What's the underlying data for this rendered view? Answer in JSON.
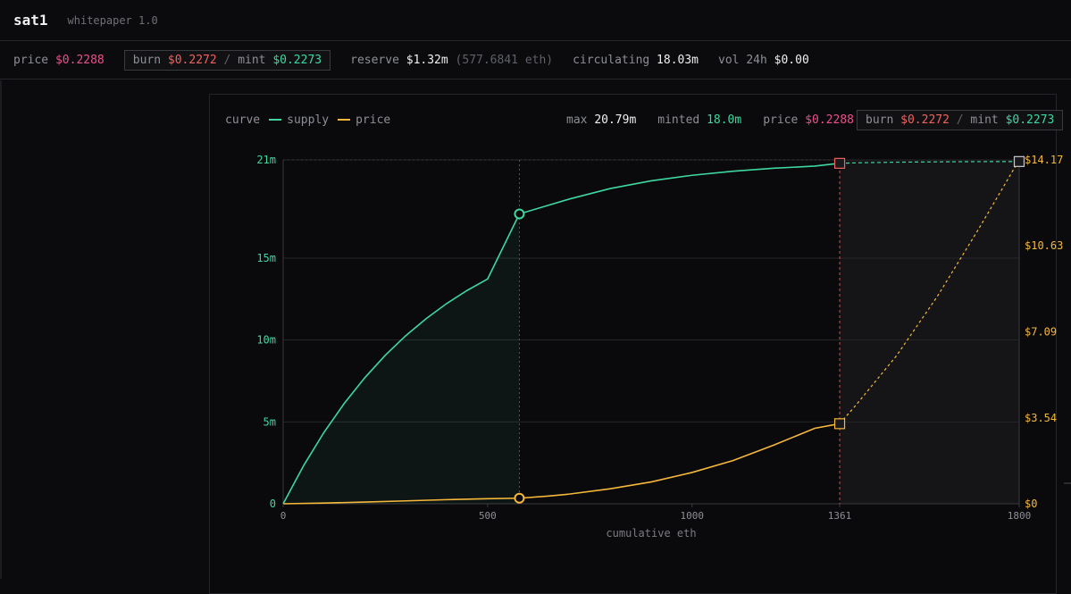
{
  "header": {
    "brand": "sat1",
    "version": "whitepaper 1.0"
  },
  "stats": {
    "price_label": "price",
    "price_value": "$0.2288",
    "burn_label": "burn",
    "burn_value": "$0.2272",
    "sep": "/",
    "mint_label": "mint",
    "mint_value": "$0.2273",
    "reserve_label": "reserve",
    "reserve_value": "$1.32m",
    "reserve_eth": "(577.6841 eth)",
    "circ_label": "circulating",
    "circ_value": "18.03m",
    "vol_label": "vol 24h",
    "vol_value": "$0.00"
  },
  "legend": {
    "curve_label": "curve",
    "supply_label": "supply",
    "price_label": "price",
    "max_label": "max",
    "max_value": "20.79m",
    "minted_label": "minted",
    "minted_value": "18.0m",
    "price_stat_label": "price",
    "price_stat_value": "$0.2288",
    "burn_label": "burn",
    "burn_value": "$0.2272",
    "sep": "/",
    "mint_label": "mint",
    "mint_value": "$0.2273"
  },
  "colors": {
    "supply": "#3fd7a0",
    "price": "#f5b83a",
    "marker": "#f0625c",
    "pink": "#ec4f8c",
    "axis_text_left": "#3fd7a0",
    "axis_text_right": "#f5b83a"
  },
  "chart_data": {
    "type": "line",
    "xlabel": "cumulative eth",
    "xlim": [
      0,
      1800
    ],
    "x_ticks": [
      0,
      500,
      1000,
      1361,
      1800
    ],
    "x_tick_labels": [
      "0",
      "500",
      "1000",
      "1361",
      "1800"
    ],
    "y_left_ticks": [
      0,
      5000000,
      10000000,
      15000000,
      21000000
    ],
    "y_left_tick_labels": [
      "0",
      "5m",
      "10m",
      "15m",
      "21m"
    ],
    "y_left_lim": [
      0,
      21000000
    ],
    "y_right_ticks": [
      0,
      3.54,
      7.09,
      10.63,
      14.17
    ],
    "y_right_tick_labels": [
      "$0",
      "$3.54",
      "$7.09",
      "$10.63",
      "$14.17"
    ],
    "y_right_lim": [
      0,
      14.17
    ],
    "grid": true,
    "current_eth": 577.6841,
    "cap_eth": 1361,
    "series": [
      {
        "name": "supply",
        "axis": "left",
        "x": [
          0,
          50,
          100,
          150,
          200,
          250,
          300,
          350,
          400,
          450,
          500,
          577.68,
          650,
          700,
          800,
          900,
          1000,
          1100,
          1200,
          1300,
          1361,
          1400,
          1500,
          1600,
          1700,
          1800
        ],
        "y": [
          0,
          2330000,
          4370000,
          6150000,
          7710000,
          9080000,
          10270000,
          11310000,
          12230000,
          13030000,
          13730000,
          17700000,
          18240000,
          18610000,
          19250000,
          19720000,
          20060000,
          20310000,
          20490000,
          20620000,
          20790000,
          20820000,
          20860000,
          20880000,
          20895000,
          20900000
        ]
      },
      {
        "name": "price",
        "axis": "right",
        "x": [
          0,
          100,
          200,
          300,
          400,
          500,
          577.68,
          650,
          700,
          800,
          900,
          1000,
          1100,
          1200,
          1300,
          1361,
          1400,
          1500,
          1600,
          1700,
          1800
        ],
        "y": [
          0,
          0.03,
          0.07,
          0.12,
          0.17,
          0.21,
          0.23,
          0.32,
          0.4,
          0.62,
          0.9,
          1.29,
          1.78,
          2.42,
          3.11,
          3.3,
          4.05,
          6.1,
          8.55,
          11.3,
          14.17
        ]
      }
    ]
  }
}
